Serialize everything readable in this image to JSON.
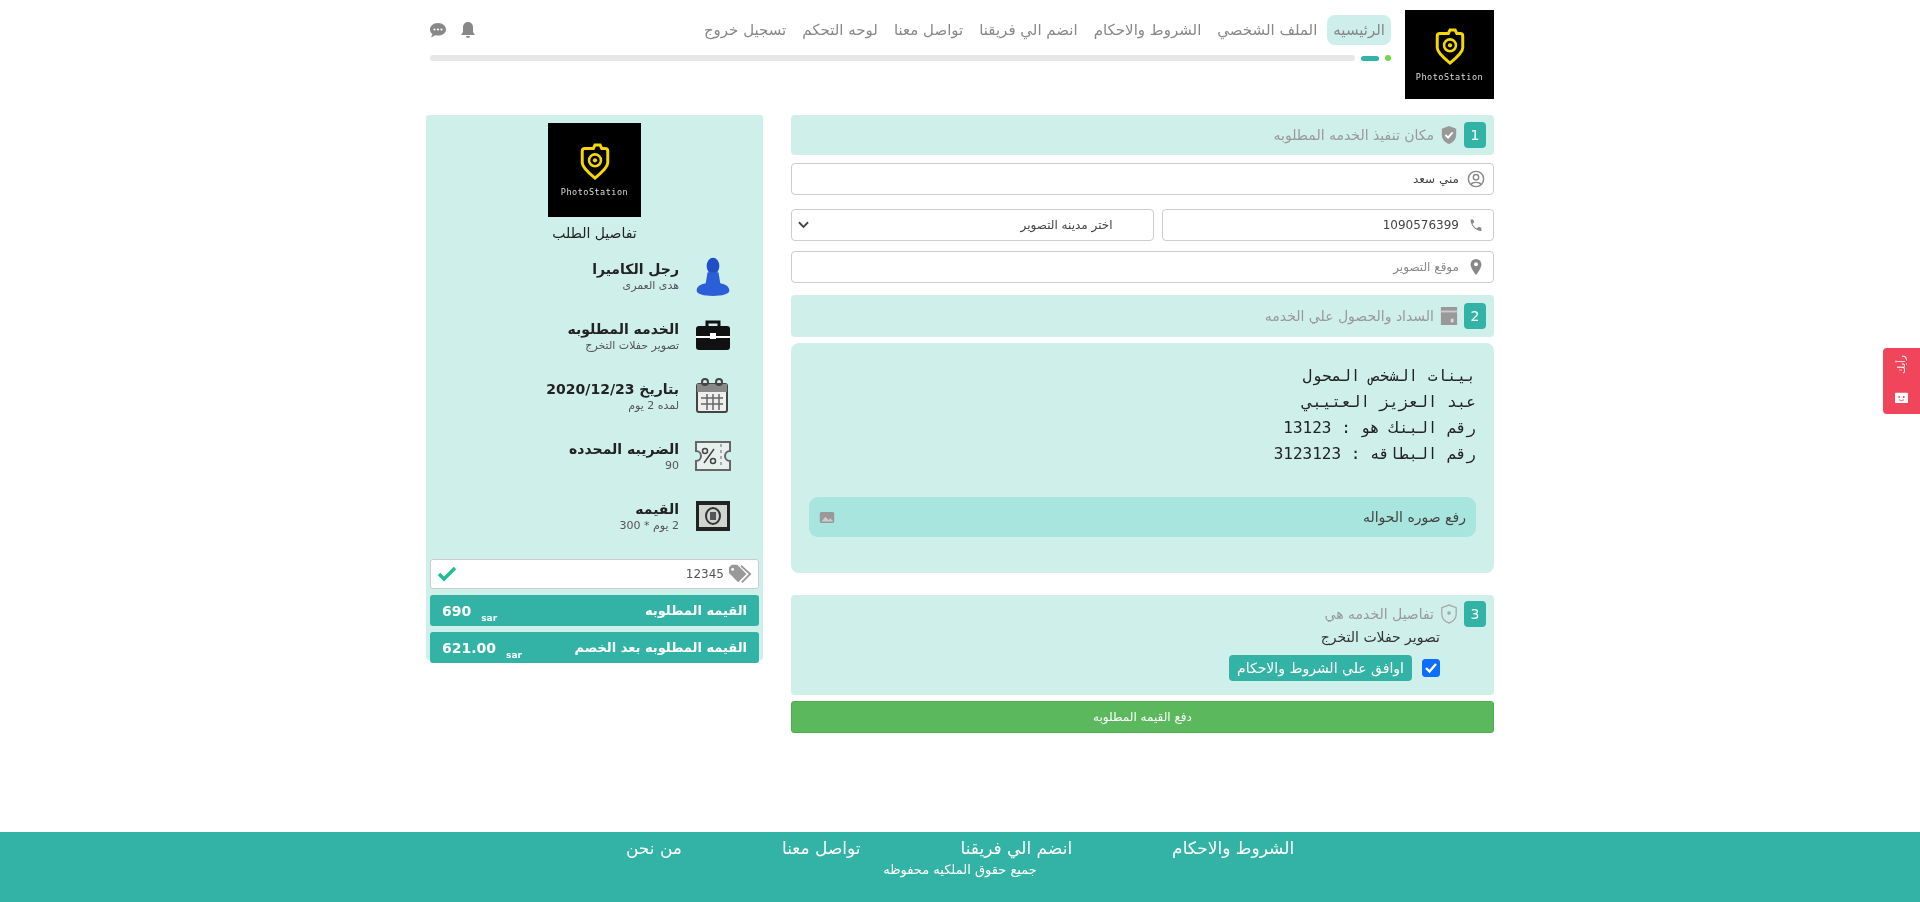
{
  "header": {
    "logo_text": "PhotoStation",
    "nav": [
      {
        "label": "الرئيسيه",
        "selected": true
      },
      {
        "label": "الملف الشخصي",
        "selected": false
      },
      {
        "label": "الشروط والاحكام",
        "selected": false
      },
      {
        "label": "انضم الي فريقنا",
        "selected": false
      },
      {
        "label": "تواصل معنا",
        "selected": false
      },
      {
        "label": "لوحه التحكم",
        "selected": false
      },
      {
        "label": "تسجيل خروج",
        "selected": false
      }
    ]
  },
  "form": {
    "section_1": {
      "number": "1",
      "title": "مكان تنفيذ الخدمه المطلوبه",
      "name_field": {
        "value": "مني سعد"
      },
      "phone_field": {
        "value": "1090576399"
      },
      "city_select": {
        "value": "اختر مدينه التصوير"
      },
      "location_field": {
        "placeholder": "موقع التصوير"
      }
    },
    "section_2": {
      "number": "2",
      "title": "السداد والحصول علي الخدمه",
      "transfer_lines": [
        "بينات الشخص المحول",
        "عبد العزيز العتيبي",
        "رقم البنك هو : 13123",
        "رقم البطاقه : 3123123"
      ],
      "upload_field": {
        "placeholder": "رفع صوره الحواله"
      }
    },
    "section_3": {
      "number": "3",
      "title": "تفاصيل الخدمه هي",
      "service": "تصوير حفلات التخرج",
      "terms": {
        "label": "اوافق علي الشروط والاحكام",
        "checked": true
      }
    },
    "pay_button": "دفع القيمه المطلوبه"
  },
  "summary": {
    "logo_text": "PhotoStation",
    "title": "تفاصيل الطلب",
    "items": [
      {
        "kind": "person",
        "title": "رجل الكاميرا",
        "detail": "هدى العمرى"
      },
      {
        "kind": "briefcase",
        "title": "الخدمه المطلوبه",
        "detail": "تصوير حفلات التخرج"
      },
      {
        "kind": "calendar",
        "title": "بتاريخ 2020/12/23",
        "detail": "لمده 2 يوم"
      },
      {
        "kind": "tax",
        "title": "الضريبه المحدده",
        "detail": "90"
      },
      {
        "kind": "money",
        "title": "القيمه",
        "detail": "2 يوم *  300"
      }
    ],
    "coupon": {
      "value": "12345",
      "valid": true
    },
    "totals": [
      {
        "label": "القيمه المطلوبه",
        "amount": "690",
        "currency": "sar"
      },
      {
        "label": "القيمه المطلوبه بعد الخصم",
        "amount": "621.00",
        "currency": "sar"
      }
    ]
  },
  "feedback_tab": {
    "label": "رأيك"
  },
  "footer": {
    "links": [
      "الشروط والاحكام",
      "انضم الي فريقنا",
      "تواصل معنا",
      "من نحن"
    ],
    "copyright": "جميع حقوق الملكيه محفوظه"
  }
}
